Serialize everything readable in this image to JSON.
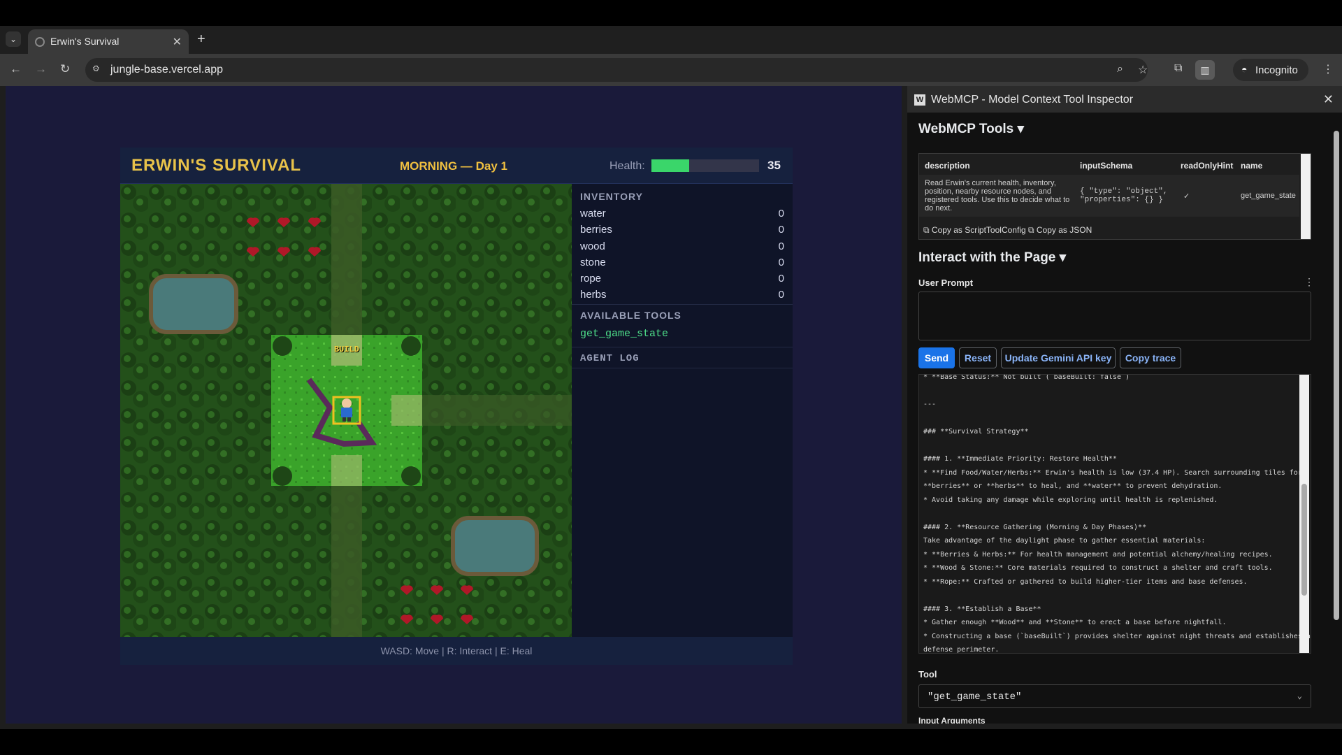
{
  "browser": {
    "tab_title": "Erwin's Survival",
    "url": "jungle-base.vercel.app",
    "incognito_label": "Incognito",
    "new_tab_glyph": "+",
    "close_tab_glyph": "✕"
  },
  "game": {
    "title": "ERWIN'S SURVIVAL",
    "phase": "MORNING — Day 1",
    "health_label": "Health:",
    "health_value": "35",
    "health_fraction": 0.35,
    "build_label": "BUILD",
    "inventory_header": "INVENTORY",
    "inventory": [
      {
        "name": "water",
        "count": "0"
      },
      {
        "name": "berries",
        "count": "0"
      },
      {
        "name": "wood",
        "count": "0"
      },
      {
        "name": "stone",
        "count": "0"
      },
      {
        "name": "rope",
        "count": "0"
      },
      {
        "name": "herbs",
        "count": "0"
      }
    ],
    "tools_header": "AVAILABLE TOOLS",
    "tool": "get_game_state",
    "agent_log_header": "AGENT LOG",
    "controls": "WASD: Move | R: Interact | E: Heal"
  },
  "inspector": {
    "title": "WebMCP - Model Context Tool Inspector",
    "tools_heading": "WebMCP Tools ▾",
    "table": {
      "headers": [
        "description",
        "inputSchema",
        "readOnlyHint",
        "name"
      ],
      "row": {
        "description": "Read Erwin's current health, inventory, position, nearby resource nodes, and registered tools. Use this to decide what to do next.",
        "input_schema": "{ \"type\": \"object\", \"properties\": {} }",
        "read_only": "✓",
        "name": "get_game_state"
      },
      "copy_config": "Copy as ScriptToolConfig",
      "copy_json": "Copy as JSON"
    },
    "interact_heading": "Interact with the Page ▾",
    "user_prompt_label": "User Prompt",
    "buttons": {
      "send": "Send",
      "reset": "Reset",
      "update_key": "Update Gemini API key",
      "copy_trace": "Copy trace"
    },
    "trace_lines": [
      "* **Base Status:** Not built (`baseBuilt: false`)",
      "",
      "---",
      "",
      "### **Survival Strategy**",
      "",
      "#### 1. **Immediate Priority: Restore Health**",
      "* **Find Food/Water/Herbs:** Erwin's health is low (37.4 HP). Search surrounding tiles for",
      "**berries** or **herbs** to heal, and **water** to prevent dehydration.",
      "* Avoid taking any damage while exploring until health is replenished.",
      "",
      "#### 2. **Resource Gathering (Morning & Day Phases)**",
      "Take advantage of the daylight phase to gather essential materials:",
      "* **Berries & Herbs:** For health management and potential alchemy/healing recipes.",
      "* **Wood & Stone:** Core materials required to construct a shelter and craft tools.",
      "* **Rope:** Crafted or gathered to build higher-tier items and base defenses.",
      "",
      "#### 3. **Establish a Base**",
      "* Gather enough **Wood** and **Stone** to erect a base before nightfall.",
      "* Constructing a base (`baseBuilt`) provides shelter against night threats and establishes a",
      "defense perimeter."
    ],
    "tool_label": "Tool",
    "tool_value": "\"get_game_state\"",
    "input_args_label": "Input Arguments"
  },
  "colors": {
    "accent": "#e8c24a",
    "health": "#3ad66a",
    "primary_button": "#1a73e8",
    "tool_green": "#4ee08a"
  }
}
